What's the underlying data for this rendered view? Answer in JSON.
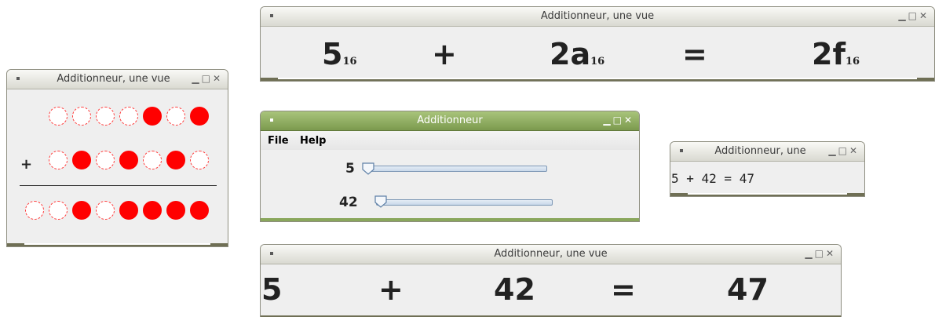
{
  "windows": {
    "binary": {
      "title": "Additionneur, une vue",
      "operator": "+",
      "row1": [
        false,
        false,
        false,
        false,
        true,
        false,
        true
      ],
      "row2": [
        false,
        true,
        false,
        true,
        false,
        true,
        false
      ],
      "row3": [
        false,
        false,
        true,
        false,
        true,
        true,
        true,
        true
      ]
    },
    "hex": {
      "title": "Additionneur, une vue",
      "a": "5",
      "a_base": "16",
      "plus": "+",
      "b": "2a",
      "b_base": "16",
      "eq": "=",
      "result": "2f",
      "result_base": "16"
    },
    "slider": {
      "title": "Additionneur",
      "menu_file": "File",
      "menu_help": "Help",
      "value1": "5",
      "value2": "42",
      "slider1_fraction": 0.0,
      "slider2_fraction": 0.0
    },
    "text": {
      "title": "Additionneur, une",
      "expression": "5 + 42 = 47"
    },
    "decimal": {
      "title": "Additionneur, une vue",
      "a": "5",
      "plus": "+",
      "b": "42",
      "eq": "=",
      "result": "47"
    }
  },
  "colors": {
    "bit_on": "#ff0000",
    "accent_green": "#8aa75c"
  },
  "icons": [
    "window-menu-icon",
    "minimize-icon",
    "maximize-icon",
    "close-icon",
    "slider-thumb-icon"
  ]
}
